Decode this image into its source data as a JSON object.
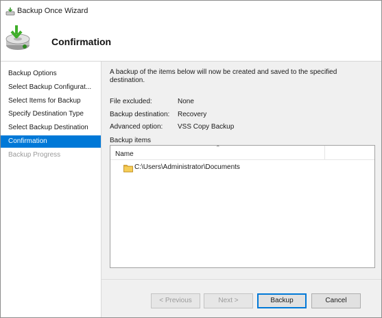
{
  "window": {
    "title": "Backup Once Wizard"
  },
  "header": {
    "title": "Confirmation"
  },
  "nav": {
    "items": [
      {
        "label": "Backup Options",
        "state": "normal"
      },
      {
        "label": "Select Backup Configurat...",
        "state": "normal"
      },
      {
        "label": "Select Items for Backup",
        "state": "normal"
      },
      {
        "label": "Specify Destination Type",
        "state": "normal"
      },
      {
        "label": "Select Backup Destination",
        "state": "normal"
      },
      {
        "label": "Confirmation",
        "state": "active"
      },
      {
        "label": "Backup Progress",
        "state": "disabled"
      }
    ]
  },
  "content": {
    "intro": "A backup of the items below will now be created and saved to the specified destination.",
    "rows": [
      {
        "label": "File excluded:",
        "value": "None"
      },
      {
        "label": "Backup destination:",
        "value": "Recovery"
      },
      {
        "label": "Advanced option:",
        "value": "VSS Copy Backup"
      }
    ],
    "items_label": "Backup items",
    "column_name": "Name",
    "files": [
      "C:\\Users\\Administrator\\Documents"
    ]
  },
  "buttons": {
    "previous": "< Previous",
    "next": "Next >",
    "backup": "Backup",
    "cancel": "Cancel"
  },
  "colors": {
    "accent": "#0078d7"
  },
  "icons": {
    "title": "backup-wizard-icon",
    "header": "backup-drive-icon",
    "folder": "folder-icon",
    "sort": "sort-up-icon"
  }
}
